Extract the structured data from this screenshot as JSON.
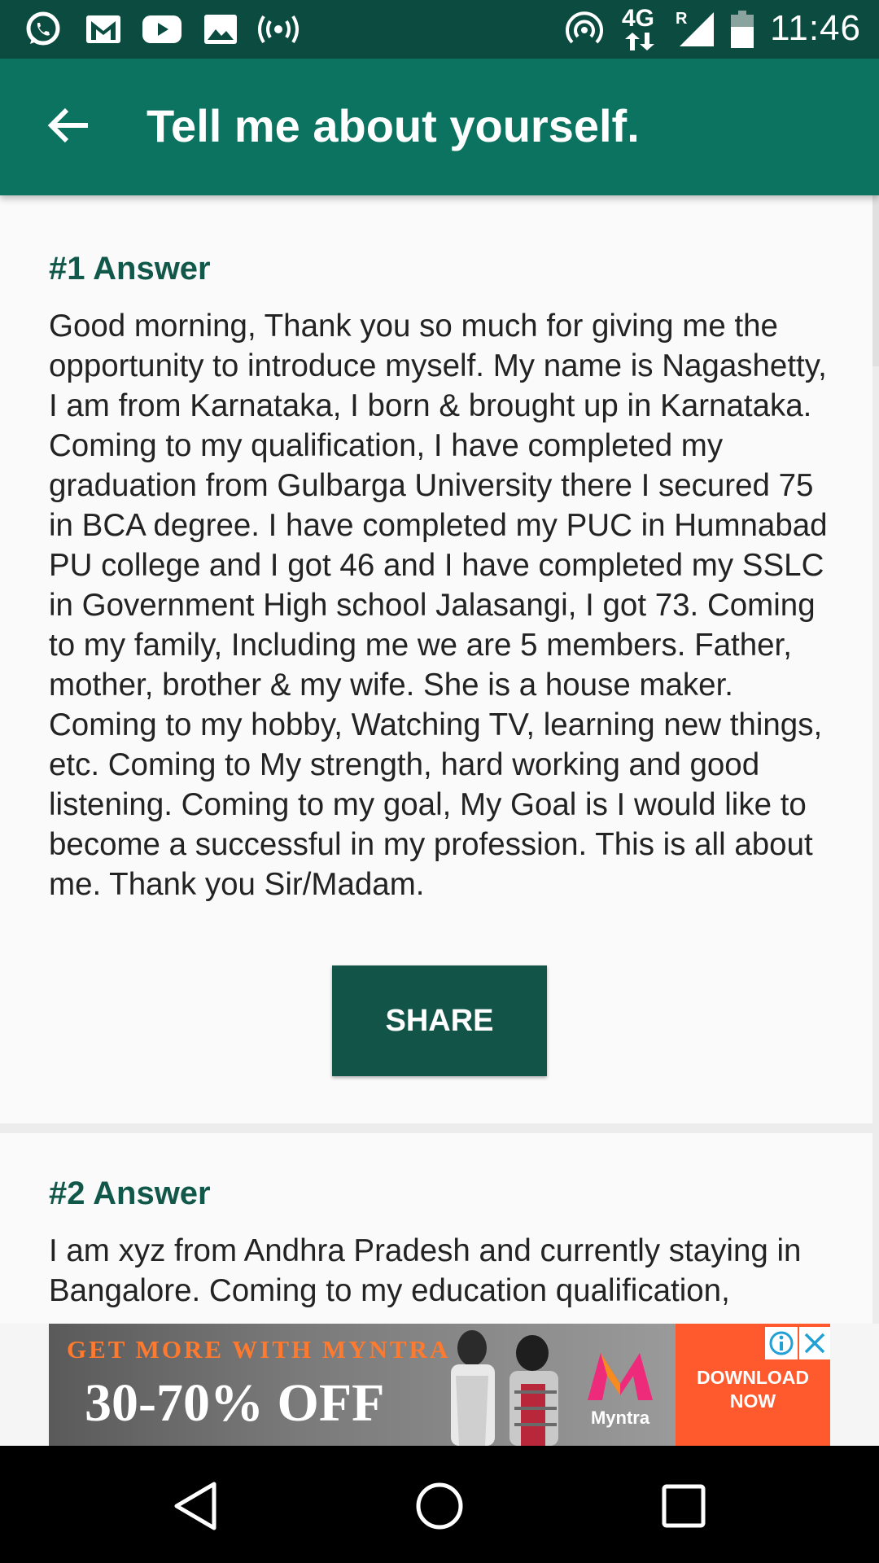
{
  "status_bar": {
    "network": "4G",
    "roaming": "R",
    "time": "11:46",
    "icons": [
      "whatsapp-icon",
      "gmail-icon",
      "youtube-icon",
      "gallery-icon",
      "broadcast-icon",
      "hotspot-icon",
      "network-arrows-icon",
      "signal-icon",
      "battery-icon"
    ]
  },
  "app_bar": {
    "title": "Tell me about yourself.",
    "back_icon": "arrow-back-icon"
  },
  "answers": [
    {
      "heading": "#1 Answer",
      "text": "Good morning, Thank you so much for giving me the opportunity to introduce myself. My name is Nagashetty, I am from Karnataka, I born & brought up in Karnataka. Coming to my qualification, I have completed my graduation from Gulbarga University there I secured 75 in BCA degree. I have completed my PUC in Humnabad PU college and I got 46 and I have completed my SSLC in Government High school Jalasangi, I got 73. Coming to my family, Including me we are 5 members. Father, mother, brother & my wife. She is a house maker. Coming to my hobby, Watching TV, learning new things, etc. Coming to My strength, hard working and good listening. Coming to my goal, My Goal is I would like to become a successful in my profession. This is all about me. Thank you Sir/Madam.",
      "share_label": "SHARE"
    },
    {
      "heading": "#2 Answer",
      "text": "I am xyz from Andhra Pradesh and currently staying in Bangalore. Coming to my education qualification,"
    }
  ],
  "ad": {
    "tagline": "GET MORE WITH MYNTRA",
    "offer": "30-70% OFF",
    "brand": "Myntra",
    "cta": "DOWNLOAD NOW",
    "colors": {
      "cta_bg": "#ff5a2e",
      "tagline": "#ff7a2e"
    }
  },
  "nav_bar": {
    "icons": [
      "back-triangle-icon",
      "home-circle-icon",
      "recents-square-icon"
    ]
  },
  "colors": {
    "status_bar": "#0c4b40",
    "app_bar": "#0d7361",
    "heading": "#11584b",
    "share_button": "#125548"
  }
}
